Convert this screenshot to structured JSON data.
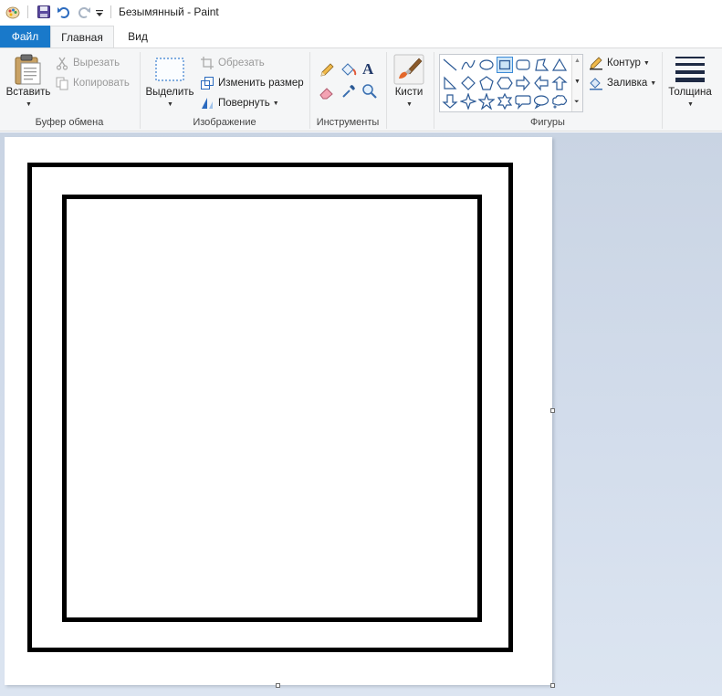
{
  "window": {
    "title": "Безымянный - Paint"
  },
  "quick_access": {
    "icons": [
      "paint-app-icon",
      "save-icon",
      "undo-icon",
      "redo-icon",
      "customize-dropdown-icon"
    ]
  },
  "tabs": [
    {
      "label": "Файл",
      "active": false
    },
    {
      "label": "Главная",
      "active": true
    },
    {
      "label": "Вид",
      "active": false
    }
  ],
  "ribbon": {
    "clipboard": {
      "paste_label": "Вставить",
      "cut_label": "Вырезать",
      "copy_label": "Копировать",
      "group_label": "Буфер обмена"
    },
    "image": {
      "select_label": "Выделить",
      "crop_label": "Обрезать",
      "resize_label": "Изменить размер",
      "rotate_label": "Повернуть",
      "group_label": "Изображение"
    },
    "tools": {
      "group_label": "Инструменты",
      "text_tool_glyph": "A"
    },
    "brushes": {
      "label": "Кисти"
    },
    "shapes": {
      "group_label": "Фигуры",
      "outline_label": "Контур",
      "fill_label": "Заливка",
      "items": [
        "line",
        "curve",
        "oval",
        "rectangle",
        "rounded-rectangle",
        "polygon",
        "triangle",
        "right-triangle",
        "diamond",
        "pentagon",
        "hexagon",
        "right-arrow",
        "left-arrow",
        "up-arrow",
        "down-arrow",
        "four-point-star",
        "five-point-star",
        "six-point-star",
        "rounded-callout",
        "oval-callout",
        "cloud-callout"
      ],
      "selected": "rectangle"
    },
    "thickness": {
      "label": "Толщина"
    }
  },
  "colors": {
    "file_tab": "#1979ca",
    "ribbon_bg": "#f5f6f7",
    "workspace": "#cfd9e8",
    "canvas": "#ffffff",
    "stroke": "#000000"
  }
}
